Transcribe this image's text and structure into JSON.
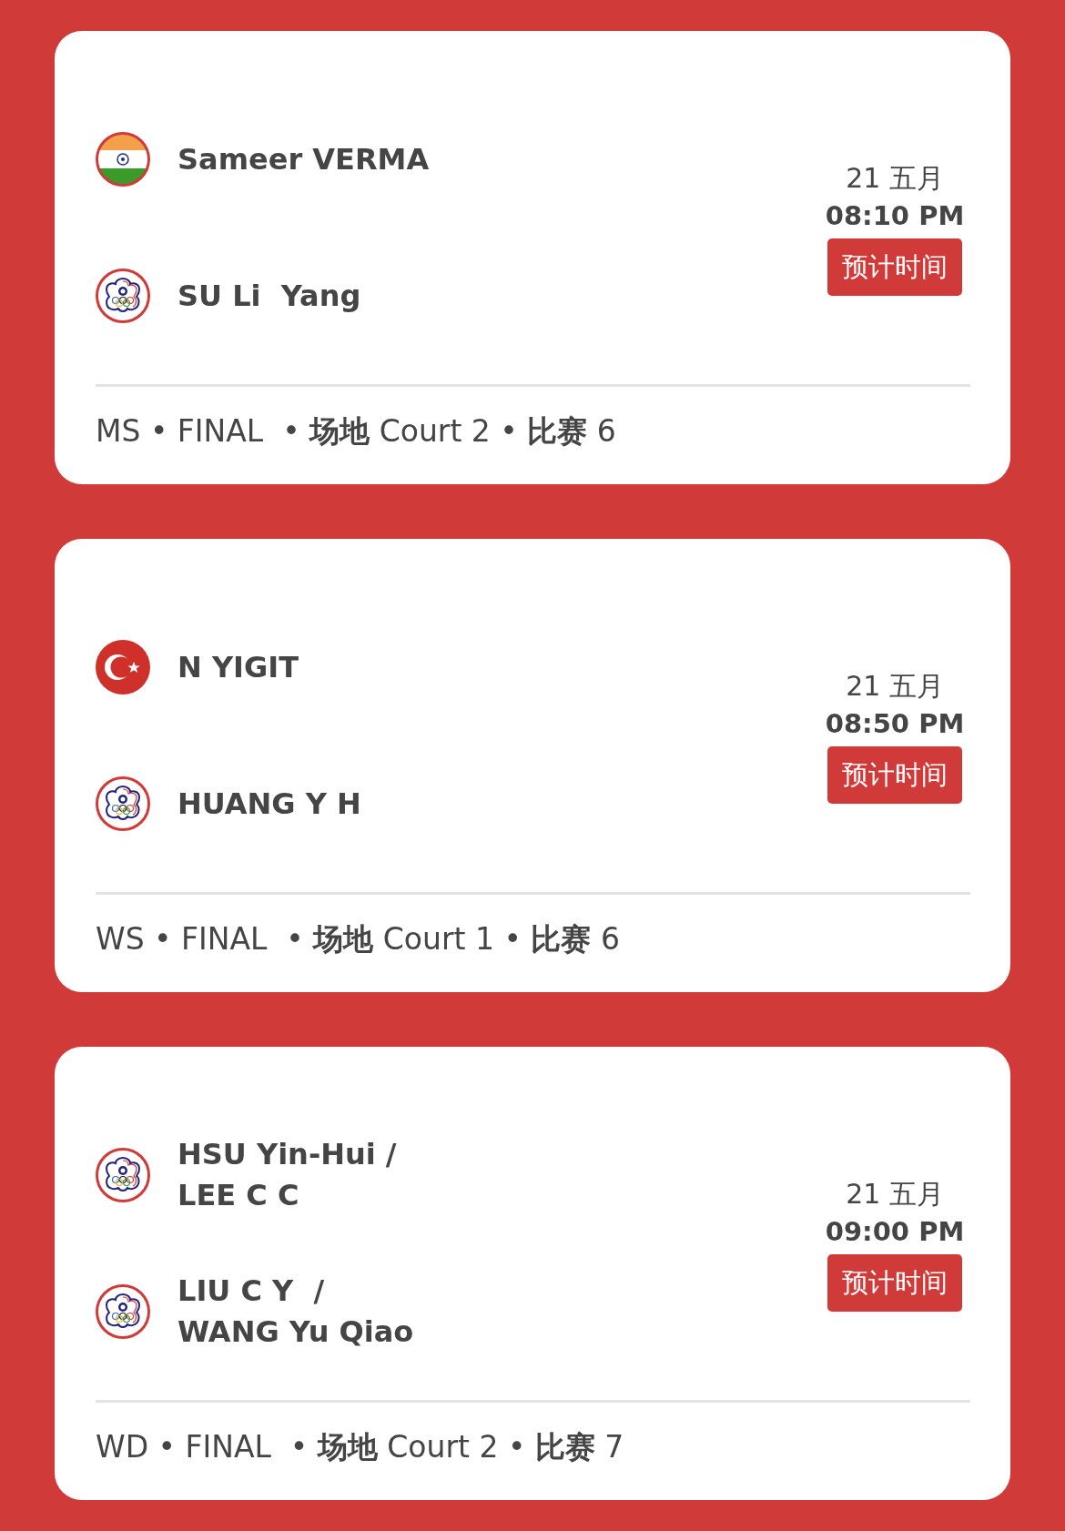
{
  "matches": [
    {
      "players": [
        {
          "kind": "india",
          "name": "Sameer VERMA"
        },
        {
          "kind": "chinese-taipei",
          "name": "SU Li  Yang"
        }
      ],
      "date": "21 五月",
      "time": "08:10 PM",
      "button": "预计时间",
      "footer": "MS • FINAL  • **场地** Court 2 • **比赛** 6"
    },
    {
      "players": [
        {
          "kind": "turkey",
          "name": "N YIGIT"
        },
        {
          "kind": "chinese-taipei",
          "name": "HUANG Y H"
        }
      ],
      "date": "21 五月",
      "time": "08:50 PM",
      "button": "预计时间",
      "footer": "WS • FINAL  • **场地** Court 1 • **比赛** 6"
    },
    {
      "players": [
        {
          "kind": "chinese-taipei",
          "name": "HSU Yin-Hui /\nLEE C C"
        },
        {
          "kind": "chinese-taipei",
          "name": "LIU C Y  /\nWANG Yu Qiao"
        }
      ],
      "date": "21 五月",
      "time": "09:00 PM",
      "button": "预计时间",
      "footer": "WD • FINAL  • **场地** Court 2 • **比赛** 7"
    }
  ]
}
